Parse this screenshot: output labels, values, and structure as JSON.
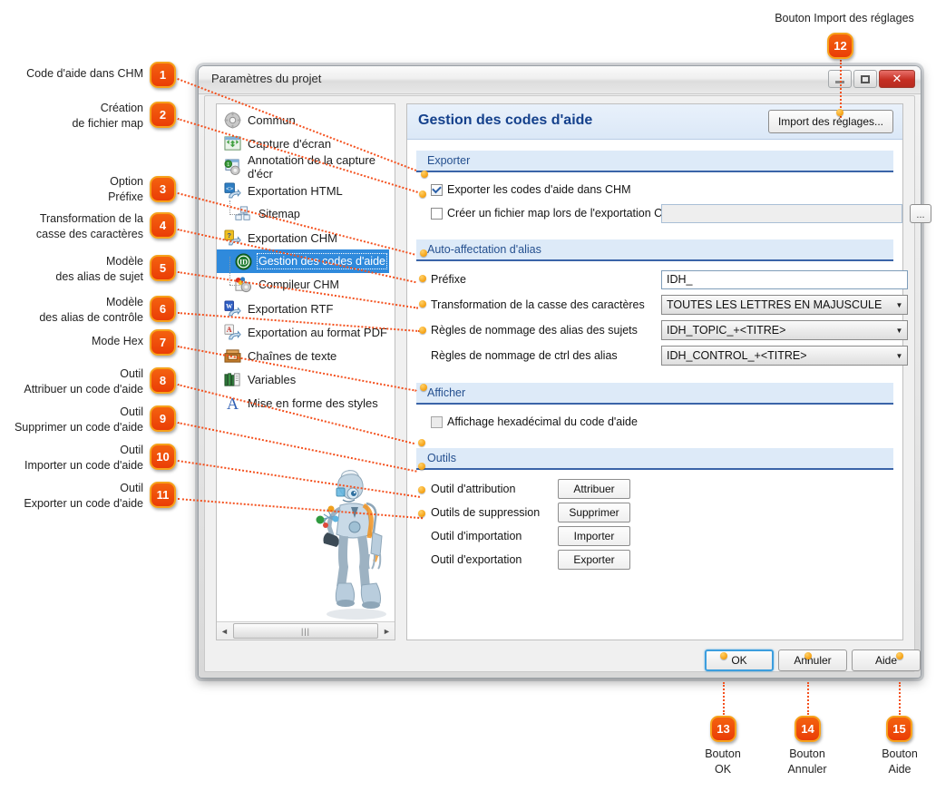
{
  "window": {
    "title": "Paramètres du projet",
    "controls": {
      "minimize": "minimize-icon",
      "maximize": "maximize-icon",
      "close": "✕"
    }
  },
  "tree": {
    "items": [
      {
        "label": "Commun",
        "icon": "gear-icon",
        "level": 0,
        "selected": false
      },
      {
        "label": "Capture d'écran",
        "icon": "screen-capture-icon",
        "level": 0,
        "selected": false
      },
      {
        "label": "Annotation de la capture d'écr",
        "icon": "annotation-icon",
        "level": 0,
        "selected": false
      },
      {
        "label": "Exportation HTML",
        "icon": "html-export-icon",
        "level": 0,
        "selected": false
      },
      {
        "label": "Sitemap",
        "icon": "sitemap-icon",
        "level": 1,
        "selected": false
      },
      {
        "label": "Exportation CHM",
        "icon": "chm-export-icon",
        "level": 0,
        "selected": false
      },
      {
        "label": "Gestion des codes d'aide",
        "icon": "id-icon",
        "level": 1,
        "selected": true
      },
      {
        "label": "Compileur CHM",
        "icon": "compiler-icon",
        "level": 1,
        "selected": false
      },
      {
        "label": "Exportation RTF",
        "icon": "rtf-export-icon",
        "level": 0,
        "selected": false
      },
      {
        "label": "Exportation au format PDF",
        "icon": "pdf-export-icon",
        "level": 0,
        "selected": false
      },
      {
        "label": "Chaînes de texte",
        "icon": "text-strings-icon",
        "level": 0,
        "selected": false
      },
      {
        "label": "Variables",
        "icon": "variables-icon",
        "level": 0,
        "selected": false
      },
      {
        "label": "Mise en forme des styles",
        "icon": "styles-icon",
        "level": 0,
        "selected": false
      }
    ],
    "scrollbar": {
      "left_arrow": "◄",
      "right_arrow": "►",
      "grip": "|||"
    }
  },
  "content": {
    "title": "Gestion des codes d'aide",
    "import_button": "Import des réglages...",
    "sections": {
      "exporter": {
        "header": "Exporter",
        "checkbox_export_chm": {
          "label": "Exporter les codes d'aide dans CHM",
          "checked": true
        },
        "checkbox_map_file": {
          "label": "Créer un fichier map lors de l'exportation CHM",
          "checked": false
        },
        "map_path_value": "",
        "browse_button": "..."
      },
      "alias": {
        "header": "Auto-affectation d'alias",
        "rows": [
          {
            "label": "Préfixe",
            "type": "text",
            "value": "IDH_"
          },
          {
            "label": "Transformation de la casse des caractères",
            "type": "combo",
            "value": "TOUTES LES LETTRES EN MAJUSCULE"
          },
          {
            "label": "Règles de nommage des alias des sujets",
            "type": "combo",
            "value": "IDH_TOPIC_+<TITRE>"
          },
          {
            "label": "Règles de nommage de ctrl des alias",
            "type": "combo",
            "value": "IDH_CONTROL_+<TITRE>"
          }
        ]
      },
      "afficher": {
        "header": "Afficher",
        "checkbox_hex": {
          "label": "Affichage hexadécimal du code d'aide",
          "checked": false
        }
      },
      "outils": {
        "header": "Outils",
        "rows": [
          {
            "label": "Outil d'attribution",
            "button": "Attribuer"
          },
          {
            "label": "Outils de suppression",
            "button": "Supprimer"
          },
          {
            "label": "Outil d'importation",
            "button": "Importer"
          },
          {
            "label": "Outil d'exportation",
            "button": "Exporter"
          }
        ]
      }
    }
  },
  "footer": {
    "ok": "OK",
    "cancel": "Annuler",
    "help": "Aide"
  },
  "callouts": {
    "left": [
      {
        "n": "1",
        "text": "Code d'aide dans CHM"
      },
      {
        "n": "2",
        "text": "Création\nde fichier map"
      },
      {
        "n": "3",
        "text": "Option\nPréfixe"
      },
      {
        "n": "4",
        "text": "Transformation de la\ncasse des caractères"
      },
      {
        "n": "5",
        "text": "Modèle\ndes alias de sujet"
      },
      {
        "n": "6",
        "text": "Modèle\ndes alias de contrôle"
      },
      {
        "n": "7",
        "text": "Mode Hex"
      },
      {
        "n": "8",
        "text": "Outil\nAttribuer un code d'aide"
      },
      {
        "n": "9",
        "text": "Outil\nSupprimer un code d'aide"
      },
      {
        "n": "10",
        "text": "Outil\nImporter un code d'aide"
      },
      {
        "n": "11",
        "text": "Outil\nExporter un code d'aide"
      }
    ],
    "top": {
      "n": "12",
      "text": "Bouton Import des réglages"
    },
    "bottom": [
      {
        "n": "13",
        "text": "Bouton\nOK"
      },
      {
        "n": "14",
        "text": "Bouton\nAnnuler"
      },
      {
        "n": "15",
        "text": "Bouton\nAide"
      }
    ]
  },
  "colors": {
    "badge": "#ea3d06",
    "badge_border": "#f6a21c",
    "leader": "#f4511e",
    "dot": "#f5a011",
    "section_header_text": "#25508f",
    "title_text": "#15418c",
    "selection": "#2f8adc"
  }
}
